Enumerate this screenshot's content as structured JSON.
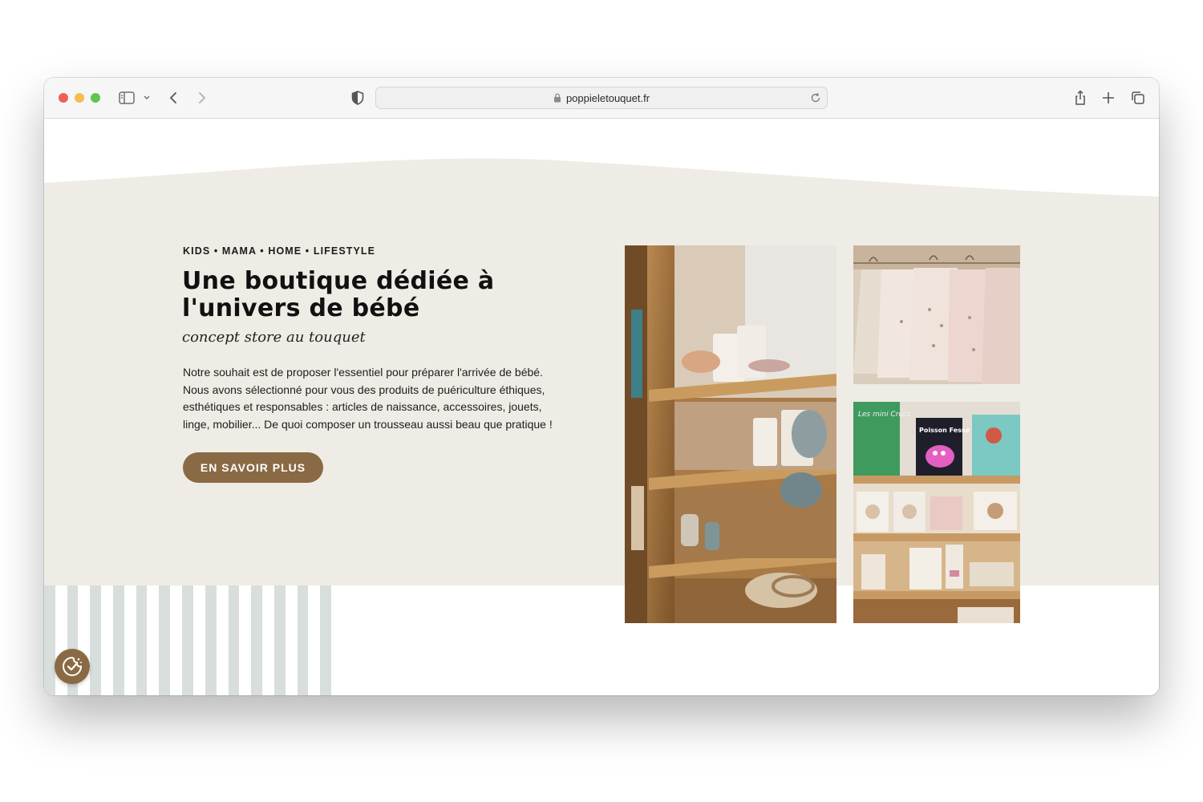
{
  "browser": {
    "url": "poppieletouquet.fr",
    "icons": {
      "sidebar": "sidebar-icon",
      "back": "chevron-left-icon",
      "forward": "chevron-right-icon",
      "privacy": "shield-icon",
      "lock": "lock-icon",
      "reload": "reload-icon",
      "share": "share-icon",
      "new_tab": "plus-icon",
      "tabs": "tabs-overview-icon"
    }
  },
  "hero": {
    "eyebrow": "KIDS • MAMA • HOME • LIFESTYLE",
    "headline": "Une boutique dédiée à l'univers de bébé",
    "script_tagline": "concept store au touquet",
    "body": "Notre souhait est de proposer l'essentiel pour préparer l'arrivée de bébé. Nous avons sélectionné pour vous des produits de puériculture éthiques, esthétiques et responsables : articles de naissance, accessoires, jouets, linge, mobilier... De quoi composer un trousseau aussi beau que pratique !",
    "cta_label": "EN SAVOIR PLUS"
  },
  "gallery": {
    "book_1_title": "Les mini Crocs",
    "book_2_title": "Poisson Fesse"
  },
  "cookie_badge": {
    "icon": "cookie-check-icon"
  },
  "colors": {
    "hero_background": "#efece6",
    "accent_brown": "#8a6a44",
    "stripe": "#d8dedc"
  }
}
